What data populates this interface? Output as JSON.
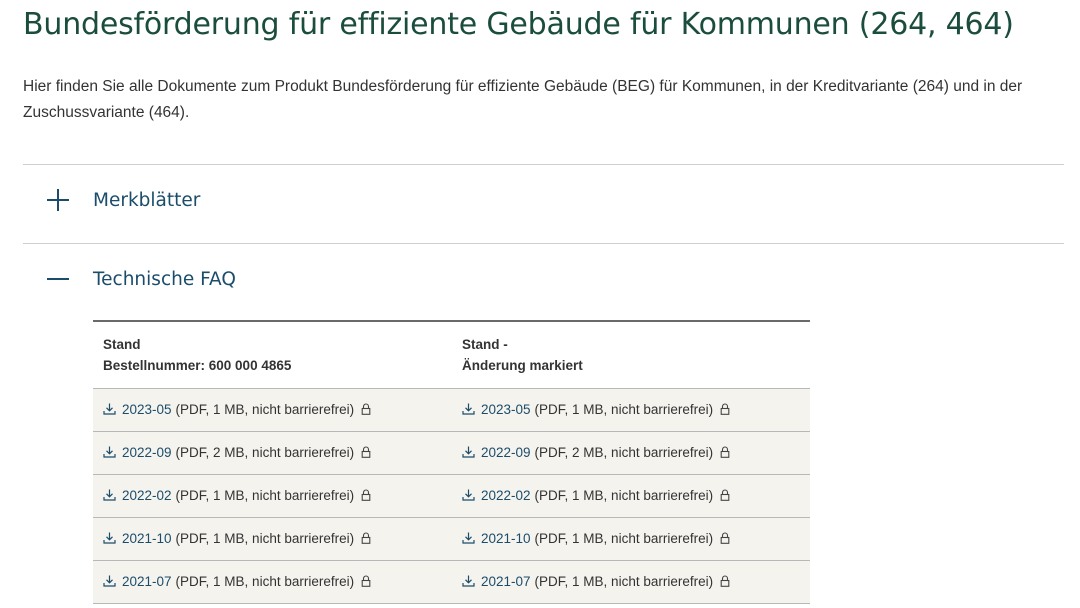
{
  "page": {
    "title": "Bundesförderung für effiziente Gebäude für Kommunen (264, 464)",
    "intro": "Hier finden Sie alle Dokumente zum Produkt Bundesförderung für effiziente Gebäude (BEG) für Kommunen, in der Kreditvariante (264) und in der Zuschussvariante (464)."
  },
  "accordion": [
    {
      "label": "Merkblätter",
      "expanded": false,
      "icon": "plus-icon"
    },
    {
      "label": "Technische FAQ",
      "expanded": true,
      "icon": "minus-icon"
    }
  ],
  "table": {
    "headers": [
      {
        "line1": "Stand",
        "line2": "Bestellnummer: 600 000 4865"
      },
      {
        "line1": "Stand -",
        "line2": "Änderung markiert"
      }
    ],
    "rows": [
      [
        {
          "date": "2023-05",
          "meta": "(PDF, 1 MB, nicht barrierefrei)"
        },
        {
          "date": "2023-05",
          "meta": "(PDF, 1 MB, nicht barrierefrei)"
        }
      ],
      [
        {
          "date": "2022-09",
          "meta": "(PDF, 2 MB, nicht barrierefrei)"
        },
        {
          "date": "2022-09",
          "meta": "(PDF, 2 MB, nicht barrierefrei)"
        }
      ],
      [
        {
          "date": "2022-02",
          "meta": "(PDF, 1 MB, nicht barrierefrei)"
        },
        {
          "date": "2022-02",
          "meta": "(PDF, 1 MB, nicht barrierefrei)"
        }
      ],
      [
        {
          "date": "2021-10",
          "meta": "(PDF, 1 MB, nicht barrierefrei)"
        },
        {
          "date": "2021-10",
          "meta": "(PDF, 1 MB, nicht barrierefrei)"
        }
      ],
      [
        {
          "date": "2021-07",
          "meta": "(PDF, 1 MB, nicht barrierefrei)"
        },
        {
          "date": "2021-07",
          "meta": "(PDF, 1 MB, nicht barrierefrei)"
        }
      ]
    ]
  },
  "icons": {
    "download": "download-icon",
    "lock": "lock-icon"
  },
  "colors": {
    "title": "#1b4d3e",
    "link": "#1b4d6b",
    "row_background": "#f5f3ee",
    "divider": "#cfcfcf"
  }
}
